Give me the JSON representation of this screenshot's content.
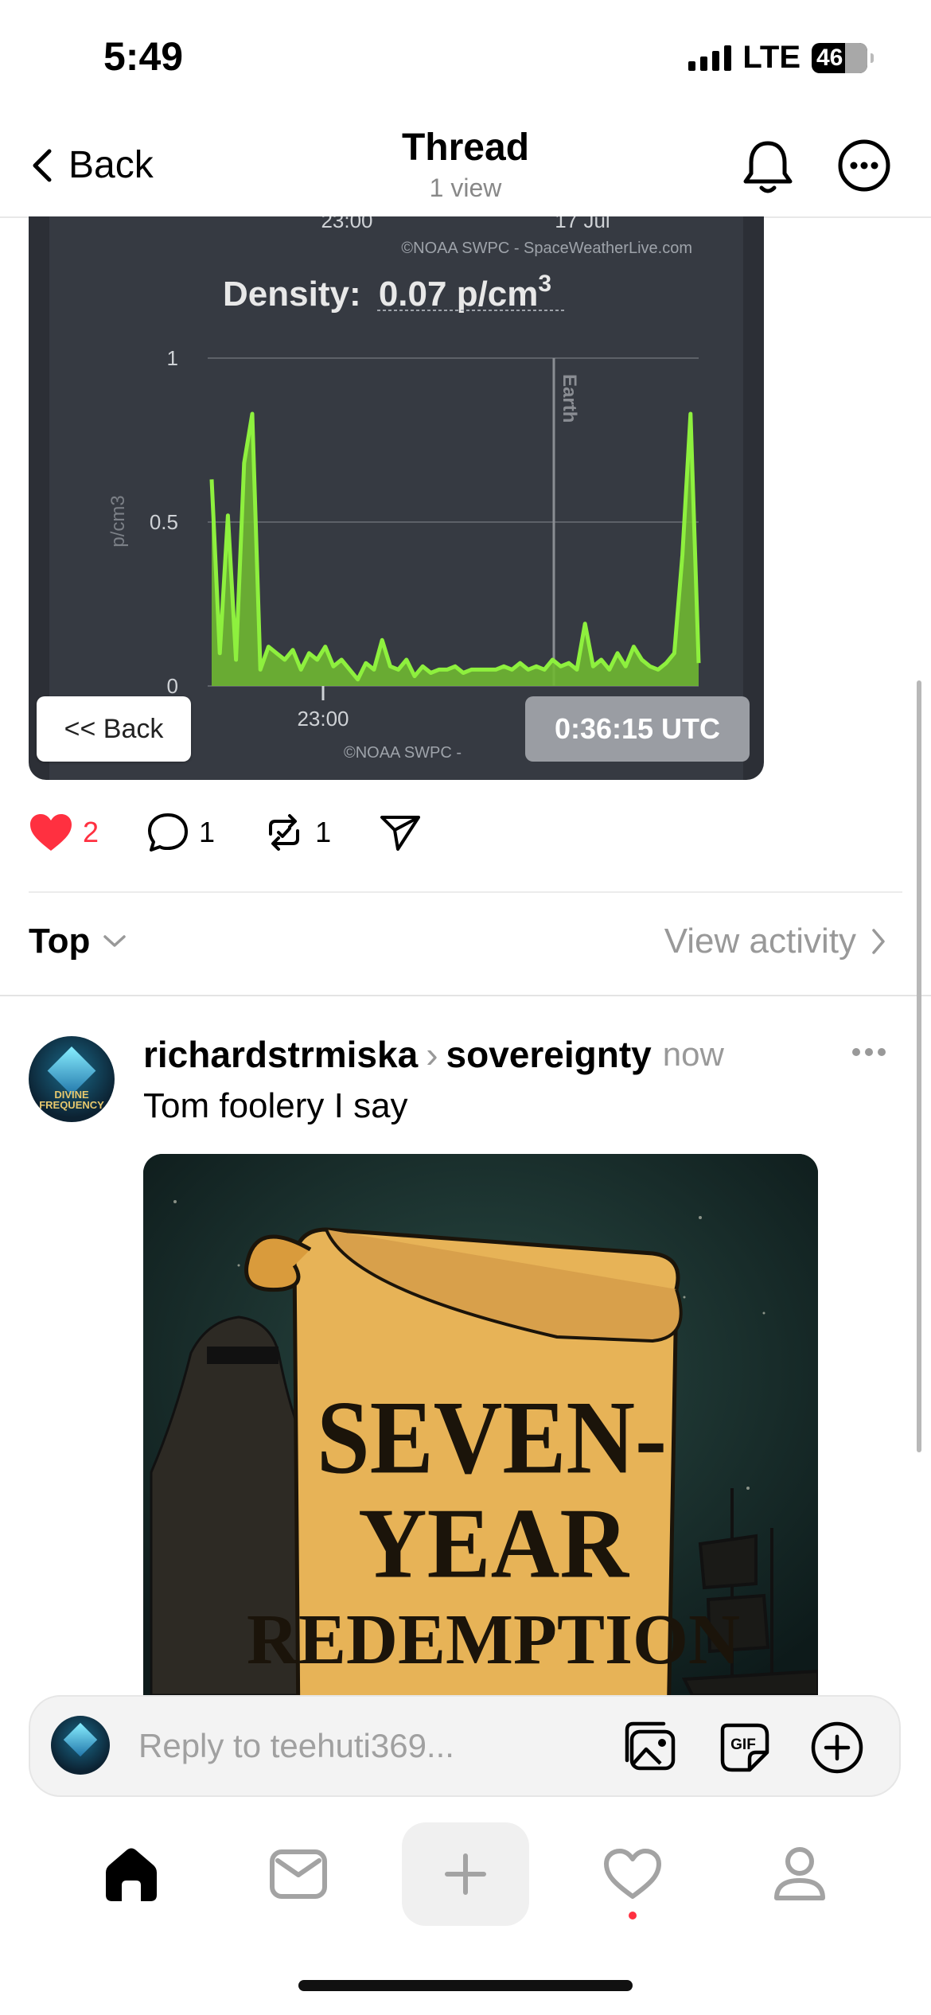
{
  "status_bar": {
    "time": "5:49",
    "network": "LTE",
    "battery": "46"
  },
  "header": {
    "back_label": "Back",
    "title": "Thread",
    "subtitle": "1 view"
  },
  "chart_card": {
    "top_time_label": "23:00",
    "top_date_label": "17 Jul",
    "credit_top": "©NOAA SWPC - SpaceWeatherLive.com",
    "density_title_prefix": "Density:",
    "density_value": "0.07 p/cm",
    "density_exp": "3",
    "earth_label": "Earth",
    "credit_bottom": "©NOAA SWPC - ",
    "back_button": "<< Back",
    "utc_time": "0:36:15 UTC",
    "chart_data": {
      "type": "line",
      "title": "Density: 0.07 p/cm3",
      "ylabel": "p/cm3",
      "xlabel": "",
      "ylim": [
        0,
        1
      ],
      "yticks": [
        "0",
        "0.5",
        "1"
      ],
      "xticks": [
        "23:00"
      ],
      "series_color": "#86e83a",
      "x": [
        0,
        1,
        2,
        3,
        4,
        5,
        6,
        7,
        8,
        9,
        10,
        11,
        12,
        13,
        14,
        15,
        16,
        17,
        18,
        19,
        20,
        21,
        22,
        23,
        24,
        25,
        26,
        27,
        28,
        29,
        30,
        31,
        32,
        33,
        34,
        35,
        36,
        37,
        38,
        39,
        40,
        41,
        42,
        43,
        44,
        45,
        46,
        47,
        48,
        49,
        50,
        51,
        52,
        53,
        54,
        55,
        56,
        57,
        58,
        59,
        60
      ],
      "values": [
        0.63,
        0.1,
        0.52,
        0.08,
        0.68,
        0.83,
        0.05,
        0.12,
        0.1,
        0.08,
        0.11,
        0.05,
        0.1,
        0.08,
        0.12,
        0.06,
        0.08,
        0.05,
        0.02,
        0.07,
        0.05,
        0.14,
        0.06,
        0.05,
        0.08,
        0.03,
        0.06,
        0.04,
        0.05,
        0.05,
        0.06,
        0.04,
        0.05,
        0.05,
        0.05,
        0.05,
        0.06,
        0.05,
        0.07,
        0.05,
        0.06,
        0.05,
        0.08,
        0.06,
        0.07,
        0.05,
        0.19,
        0.06,
        0.08,
        0.05,
        0.1,
        0.06,
        0.12,
        0.08,
        0.06,
        0.05,
        0.07,
        0.1,
        0.4,
        0.83,
        0.07
      ]
    }
  },
  "actions": {
    "likes": "2",
    "comments": "1",
    "reposts": "1"
  },
  "sort": {
    "label": "Top",
    "view_activity": "View activity"
  },
  "reply_post": {
    "username": "richardstrmiska",
    "topic": "sovereignty",
    "time": "now",
    "text": "Tom foolery I say",
    "image_title_line1": "SEVEN-",
    "image_title_line2": "YEAR",
    "image_title_line3": "REDEMPTION",
    "avatar_text": "DIVINE FREQUENCY"
  },
  "reply_bar": {
    "placeholder": "Reply to teehuti369..."
  },
  "colors": {
    "accent_like": "#ff3040",
    "chart_bg": "#363a42",
    "chart_line": "#86e83a"
  }
}
